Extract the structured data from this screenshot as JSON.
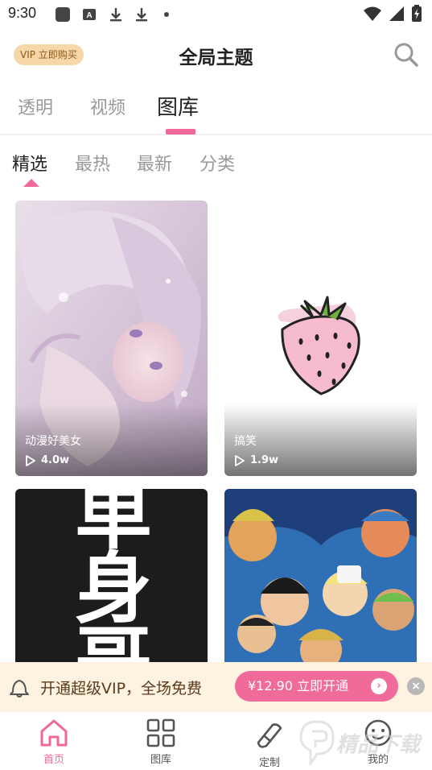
{
  "status_bar": {
    "time": "9:30"
  },
  "header": {
    "vip_badge": "VIP 立即购买",
    "title": "全局主题"
  },
  "top_tabs": [
    {
      "label": "透明"
    },
    {
      "label": "视频"
    },
    {
      "label": "图库"
    }
  ],
  "sub_tabs": [
    {
      "label": "精选"
    },
    {
      "label": "最热"
    },
    {
      "label": "最新"
    },
    {
      "label": "分类"
    }
  ],
  "cards": [
    {
      "label": "动漫好美女",
      "views": "4.0w"
    },
    {
      "label": "搞笑",
      "views": "1.9w"
    },
    {
      "label": "",
      "views": "",
      "poster_text": "单身哥"
    },
    {
      "label": "",
      "views": ""
    }
  ],
  "vip_banner": {
    "text": "开通超级VIP，全场免费",
    "button": "¥12.90 立即开通",
    "close": "×"
  },
  "bottom_nav": [
    {
      "label": "首页",
      "icon": "home-icon"
    },
    {
      "label": "图库",
      "icon": "grid-icon"
    },
    {
      "label": "定制",
      "icon": "brush-icon"
    },
    {
      "label": "我的",
      "icon": "smile-icon"
    }
  ],
  "watermark": {
    "text": "精品下载"
  },
  "colors": {
    "accent": "#f0699a",
    "vip_gold": "#f7d7a8",
    "banner_bg": "#fdf3e0"
  }
}
